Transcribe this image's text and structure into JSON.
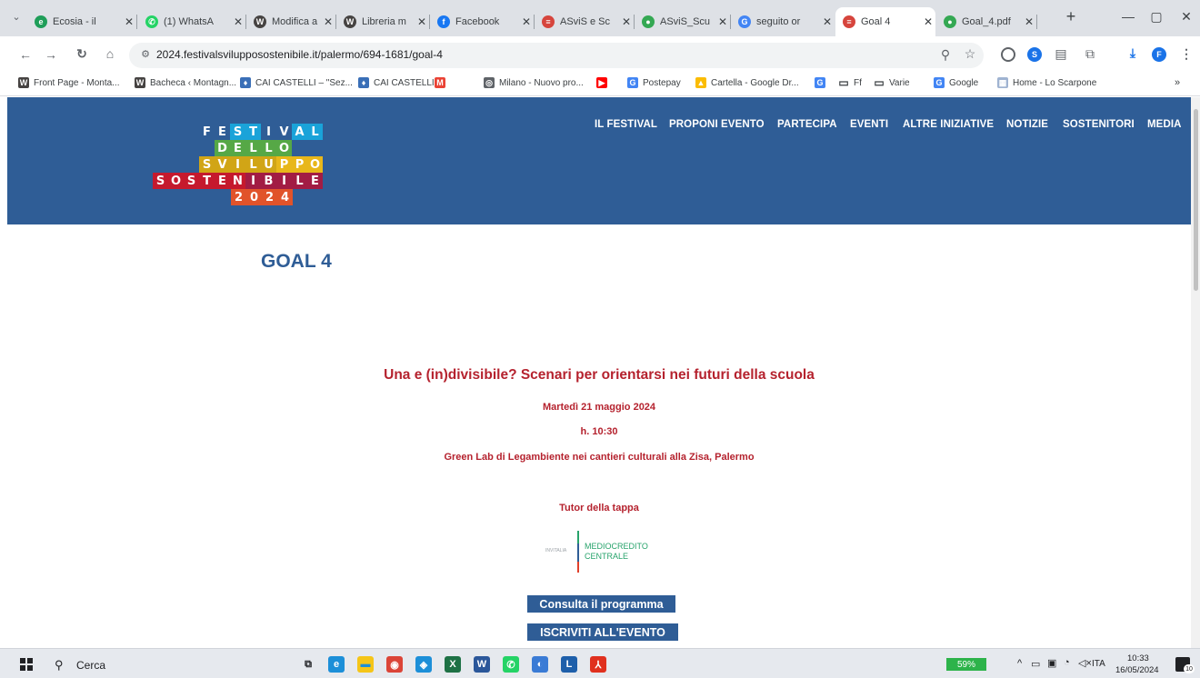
{
  "tabs": [
    {
      "title": "Ecosia - il",
      "icon": "ecosia-icon",
      "color": "#1f9e59",
      "glyph": "e"
    },
    {
      "title": "(1) WhatsA",
      "icon": "whatsapp-icon",
      "color": "#25d366",
      "glyph": "✆"
    },
    {
      "title": "Modifica a",
      "icon": "wordpress-icon",
      "color": "#464342",
      "glyph": "W"
    },
    {
      "title": "Libreria m",
      "icon": "wordpress-icon",
      "color": "#464342",
      "glyph": "W"
    },
    {
      "title": "Facebook",
      "icon": "facebook-icon",
      "color": "#1877f2",
      "glyph": "f"
    },
    {
      "title": "ASviS e Sc",
      "icon": "asvis-icon",
      "color": "#d6453d",
      "glyph": "≡"
    },
    {
      "title": "ASviS_Scu",
      "icon": "sheet-icon",
      "color": "#34a853",
      "glyph": "●"
    },
    {
      "title": "seguito or",
      "icon": "google-icon",
      "color": "#4285f4",
      "glyph": "G"
    },
    {
      "title": "Goal 4",
      "icon": "asvis-icon",
      "color": "#d6453d",
      "glyph": "≡"
    },
    {
      "title": "Goal_4.pdf",
      "icon": "pdf-icon",
      "color": "#34a853",
      "glyph": "●"
    }
  ],
  "toolbar": {
    "url": "2024.festivalsvilupposostenibile.it/palermo/694-1681/goal-4"
  },
  "bookmarks": [
    {
      "label": "Front Page - Monta...",
      "icon": "wordpress-icon",
      "color": "#464342",
      "glyph": "W"
    },
    {
      "label": "Bacheca ‹ Montagn...",
      "icon": "wordpress-icon",
      "color": "#464342",
      "glyph": "W"
    },
    {
      "label": "CAI CASTELLI – \"Sez...",
      "icon": "cai-icon",
      "color": "#3a6fb7",
      "glyph": "♦"
    },
    {
      "label": "CAI CASTELLI",
      "icon": "cai-icon",
      "color": "#3a6fb7",
      "glyph": "♦"
    },
    {
      "label": "",
      "icon": "gmail-icon",
      "color": "#ea4335",
      "glyph": "M"
    },
    {
      "label": "Milano - Nuovo pro...",
      "icon": "globe-icon",
      "color": "#5f6368",
      "glyph": "◎"
    },
    {
      "label": "",
      "icon": "youtube-icon",
      "color": "#ff0000",
      "glyph": "▶"
    },
    {
      "label": "Postepay",
      "icon": "google-icon",
      "color": "#4285f4",
      "glyph": "G"
    },
    {
      "label": "Cartella - Google Dr...",
      "icon": "drive-icon",
      "color": "#fbbc04",
      "glyph": "▲"
    },
    {
      "label": "",
      "icon": "google-icon",
      "color": "#4285f4",
      "glyph": "G"
    },
    {
      "label": "Ff",
      "icon": "folder-icon",
      "color": "#5f6368",
      "glyph": "▭"
    },
    {
      "label": "Varie",
      "icon": "folder-icon",
      "color": "#5f6368",
      "glyph": "▭"
    },
    {
      "label": "Google",
      "icon": "google-icon",
      "color": "#4285f4",
      "glyph": "G"
    },
    {
      "label": "Home - Lo Scarpone",
      "icon": "scarpone-icon",
      "color": "#9fb3d1",
      "glyph": "▦"
    }
  ],
  "site": {
    "logo_rows": [
      {
        "text": "FESTIVAL",
        "colors": [
          "#2f5d96",
          "#2f5d96",
          "#1aa3d9",
          "#1aa3d9",
          "#2f5d96",
          "#2f5d96",
          "#1aa3d9",
          "#1aa3d9"
        ]
      },
      {
        "text": "DELLO",
        "colors": [
          "#56a846",
          "#56a846",
          "#56a846",
          "#56a846",
          "#56a846"
        ]
      },
      {
        "text": "SVILUPPO",
        "colors": [
          "#d1a516",
          "#d1a516",
          "#d1a516",
          "#d1a516",
          "#d1a516",
          "#e8b71a",
          "#e8b71a",
          "#e8b71a"
        ]
      },
      {
        "text": "SOSTENIBILE",
        "colors": [
          "#c5192d",
          "#c5192d",
          "#c5192d",
          "#c5192d",
          "#c5192d",
          "#c5192d",
          "#a21c44",
          "#a21c44",
          "#a21c44",
          "#a21c44",
          "#a21c44"
        ]
      },
      {
        "text": "2024",
        "colors": [
          "#e1532a",
          "#e1532a",
          "#e1532a",
          "#e1532a"
        ]
      }
    ],
    "nav": [
      "IL FESTIVAL",
      "PROPONI EVENTO",
      "PARTECIPA",
      "EVENTI",
      "ALTRE INIZIATIVE",
      "NOTIZIE",
      "SOSTENITORI",
      "MEDIA"
    ],
    "page_title": "GOAL 4",
    "event": {
      "title": "Una e (in)divisibile? Scenari per orientarsi nei futuri della scuola",
      "date": "Martedì 21 maggio 2024",
      "time": "h. 10:30",
      "place": "Green Lab di Legambiente nei cantieri culturali alla Zisa, Palermo",
      "tutor_label": "Tutor della tappa",
      "sponsor_name_1": "MEDIOCREDITO",
      "sponsor_name_2": "CENTRALE",
      "sponsor_prefix": "INVITALIA"
    },
    "cta_program": "Consulta il programma",
    "cta_register": "ISCRIVITI ALL'EVENTO"
  },
  "taskbar": {
    "search_placeholder": "Cerca",
    "battery": "59%",
    "language": "ITA",
    "time": "10:33",
    "date": "16/05/2024",
    "notifications": "10"
  }
}
